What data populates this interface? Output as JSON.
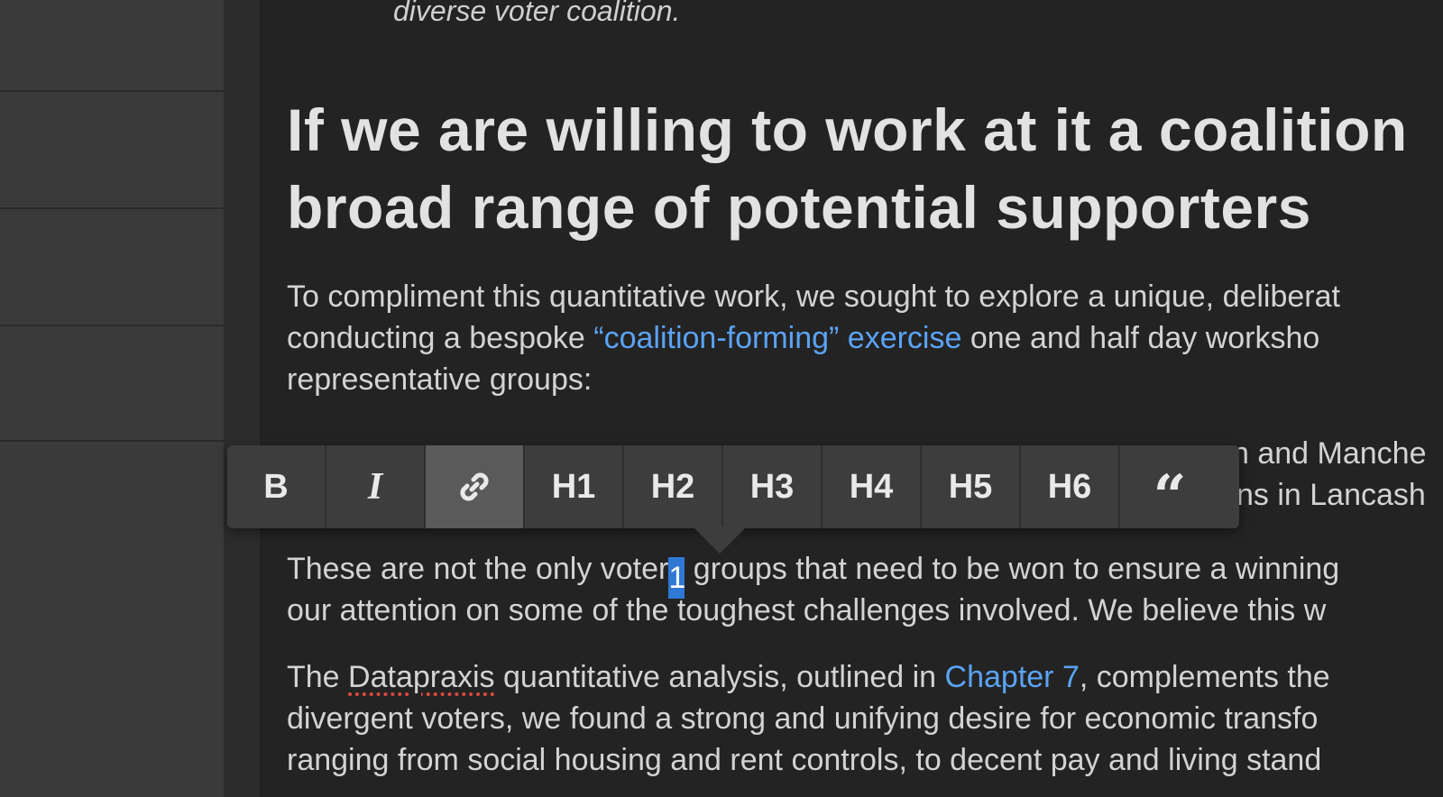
{
  "document": {
    "italic_line": "diverse voter coalition.",
    "heading_line1": "If we are willing to work at it a coalition",
    "heading_line2": "broad range of potential supporters",
    "p1_line1": "To compliment this quantitative work, we sought to explore a unique, deliberat",
    "p1_line2_pre": "conducting a bespoke ",
    "p1_line2_link": "“coalition-forming” exercise",
    "p1_line2_post": " one and half day worksho",
    "p1_line3": "representative groups:",
    "hidden_line1_tail": "n and Manche",
    "hidden_line2_tail": "yns in Lancash",
    "p2_line1_pre": "These are not the only voter",
    "p2_line1_sel": "1",
    "p2_line1_post": " groups that need to be won to ensure a winning",
    "p2_line2": "our attention on some of the toughest challenges involved. We believe this w",
    "p3_line1_pre": "The ",
    "p3_line1_misspelled": "Datapraxis",
    "p3_line1_mid": " quantitative analysis, outlined in ",
    "p3_line1_link": "Chapter 7",
    "p3_line1_post": ", complements the",
    "p3_line2": "divergent voters, we found a strong and unifying desire for economic transfo",
    "p3_line3": "ranging from social housing and rent controls, to decent pay and living stand"
  },
  "toolbar": {
    "bold": "B",
    "italic": "I",
    "link_icon": "link-icon",
    "h1": "H1",
    "h2": "H2",
    "h3": "H3",
    "h4": "H4",
    "h5": "H5",
    "h6": "H6",
    "quote": "“"
  },
  "colors": {
    "link": "#5ba3f5",
    "selection": "#2f78d6",
    "spellcheck": "#e0463e"
  }
}
